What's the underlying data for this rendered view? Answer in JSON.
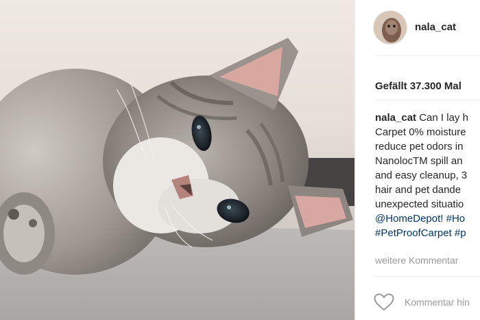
{
  "photo": {
    "subject": "tabby-cat-lying-on-carpet"
  },
  "post": {
    "username": "nala_cat",
    "likes_text": "Gefällt 37.300 Mal",
    "caption_lines": [
      "Can I lay h",
      "Carpet 0% moisture",
      "reduce pet odors in",
      "NanolocTM spill an",
      "and easy cleanup, 3",
      "hair and pet dande",
      "unexpected situatio",
      "@HomeDepot! #Ho",
      "#PetProofCarpet #p"
    ],
    "more_comments": "weitere Kommentar",
    "comment_placeholder": "Kommentar hin"
  },
  "colors": {
    "link": "#003569",
    "muted": "#999999",
    "text": "#262626"
  },
  "icons": {
    "like": "heart-outline-icon"
  }
}
